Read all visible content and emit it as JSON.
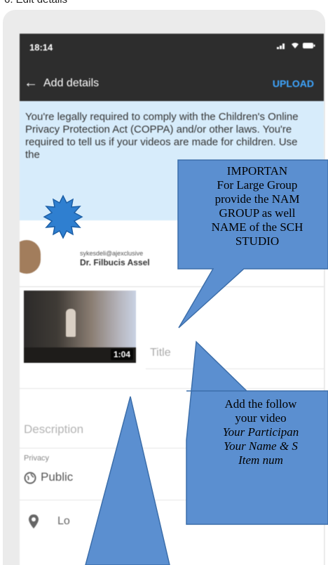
{
  "document_heading": "6. Edit details",
  "status_bar": {
    "time": "18:14",
    "icons_text": "▪ ▪ ▪"
  },
  "app_bar": {
    "back_icon": "arrow-left-icon",
    "title": "Add details",
    "upload_label": "UPLOAD"
  },
  "notice": {
    "text": "You're legally required to comply with the Children's Online Privacy Protection Act (COPPA) and/or other laws. You're required to tell us if your videos are made for children. Use the"
  },
  "account": {
    "email": "sykesdeli@ajexclusive",
    "name": "Dr. Filbucis Assel"
  },
  "video": {
    "duration": "1:04",
    "title_placeholder": "Title"
  },
  "description_placeholder": "Description",
  "privacy": {
    "label": "Privacy",
    "value": "Public"
  },
  "location": {
    "label": "Lo",
    "add_icon": "+"
  },
  "callouts": {
    "important": {
      "lines": [
        "IMPORTAN",
        "For Large Group",
        "provide the NAM",
        "GROUP as well",
        "NAME of the SCH",
        "STUDIO"
      ]
    },
    "add": {
      "lines": [
        "Add the follow",
        "your video",
        "Your Participan",
        "Your Name & S",
        "Item num"
      ]
    }
  },
  "colors": {
    "appbar": "#2d2d2d",
    "accent": "#3ea6ff",
    "notice_bg": "#d7ecfb",
    "callout_fill": "#5b8fd0",
    "callout_border": "#3c6eaa"
  }
}
